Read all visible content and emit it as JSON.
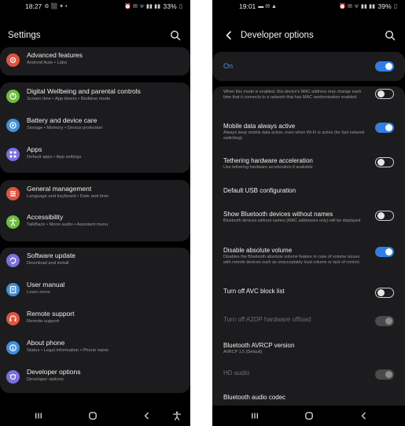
{
  "left": {
    "status": {
      "time": "18:27",
      "battery": "33%"
    },
    "title": "Settings",
    "items": [
      {
        "title": "Advanced features",
        "subtitle": "Android Auto  •  Labs",
        "color": "#e0533e",
        "icon": "gear-plus-icon"
      },
      {
        "title": "Digital Wellbeing and parental controls",
        "subtitle": "Screen time  •  App timers  •  Bedtime mode",
        "color": "#6abf3b",
        "icon": "wellbeing-icon"
      },
      {
        "title": "Battery and device care",
        "subtitle": "Storage  •  Memory  •  Device protection",
        "color": "#3f8fdc",
        "icon": "device-care-icon"
      },
      {
        "title": "Apps",
        "subtitle": "Default apps  •  App settings",
        "color": "#7a6fe0",
        "icon": "apps-grid-icon"
      },
      {
        "title": "General management",
        "subtitle": "Language and keyboard  •  Date and time",
        "color": "#e0533e",
        "icon": "sliders-icon"
      },
      {
        "title": "Accessibility",
        "subtitle": "TalkBack  •  Mono audio  •  Assistant menu",
        "color": "#6abf3b",
        "icon": "accessibility-icon"
      },
      {
        "title": "Software update",
        "subtitle": "Download and install",
        "color": "#7a6fe0",
        "icon": "update-icon"
      },
      {
        "title": "User manual",
        "subtitle": "Learn more",
        "color": "#3f8fdc",
        "icon": "manual-icon"
      },
      {
        "title": "Remote support",
        "subtitle": "Remote support",
        "color": "#e0533e",
        "icon": "headset-icon"
      },
      {
        "title": "About phone",
        "subtitle": "Status  •  Legal information  •  Phone name",
        "color": "#3f8fdc",
        "icon": "info-icon"
      },
      {
        "title": "Developer options",
        "subtitle": "Developer options",
        "color": "#7a6fe0",
        "icon": "developer-icon"
      }
    ]
  },
  "right": {
    "status": {
      "time": "19:01",
      "battery": "39%"
    },
    "title": "Developer options",
    "master": {
      "label": "On",
      "on": true
    },
    "options": [
      {
        "title": "",
        "subtitle": "When this mode is enabled, this device's MAC address may change each time that it connects to a network that has MAC randomisation enabled.",
        "toggle": "off",
        "dim": false
      },
      {
        "title": "Mobile data always active",
        "subtitle": "Always keep mobile data active, even when Wi-Fi is active (for fast network switching).",
        "toggle": "on",
        "dim": false
      },
      {
        "title": "Tethering hardware acceleration",
        "subtitle": "Use tethering hardware acceleration if available",
        "toggle": "off",
        "dim": false
      },
      {
        "title": "Default USB configuration",
        "subtitle": "",
        "toggle": "none",
        "dim": false
      },
      {
        "title": "Show Bluetooth devices without names",
        "subtitle": "Bluetooth devices without names (MAC addresses only) will be displayed",
        "toggle": "off",
        "dim": false
      },
      {
        "title": "Disable absolute volume",
        "subtitle": "Disables the Bluetooth absolute volume feature in case of volume issues with remote devices such as unacceptably loud volume or lack of control.",
        "toggle": "on",
        "dim": false
      },
      {
        "title": "Turn off AVC block list",
        "subtitle": "",
        "toggle": "off",
        "dim": false
      },
      {
        "title": "Turn off A2DP hardware offload",
        "subtitle": "",
        "toggle": "disabled",
        "dim": true
      },
      {
        "title": "Bluetooth AVRCP version",
        "subtitle": "AVRCP 1.5 (Default)",
        "toggle": "none",
        "dim": false
      },
      {
        "title": "HD audio",
        "subtitle": "",
        "toggle": "disabled",
        "dim": true
      },
      {
        "title": "Bluetooth audio codec",
        "subtitle": "",
        "toggle": "none",
        "dim": false
      }
    ]
  }
}
